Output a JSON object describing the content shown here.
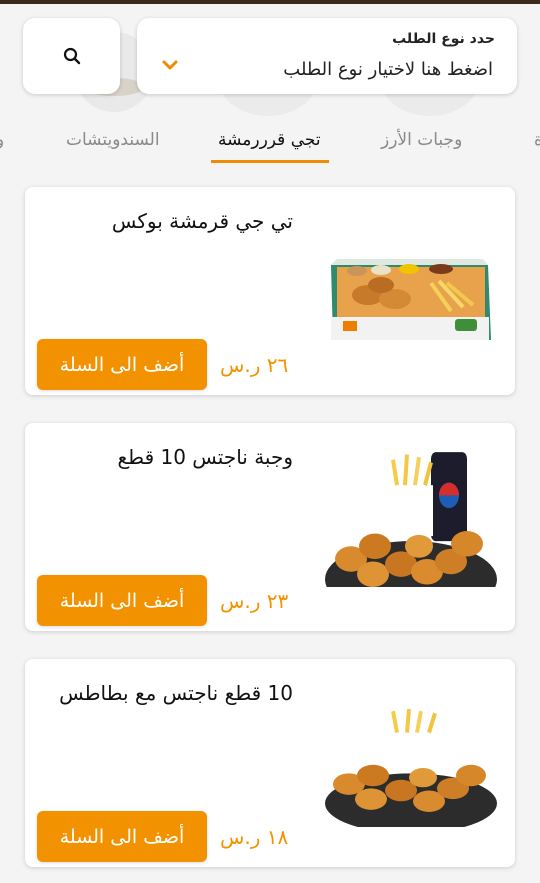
{
  "header": {
    "search_icon": "search-icon",
    "order_type": {
      "label": "حدد نوع الطلب",
      "value": "اضغط هنا لاختيار نوع الطلب"
    }
  },
  "tabs": [
    {
      "label": "و"
    },
    {
      "label": "السندويتشات"
    },
    {
      "label": "تجي قرررمشة"
    },
    {
      "label": "وجبات الأرز"
    },
    {
      "label": "ة"
    }
  ],
  "active_tab": "تجي قرررمشة",
  "products": [
    {
      "title": "تي جي قرمشة بوكس",
      "price": "٢٦ ر.س",
      "add_label": "أضف الى السلة",
      "image": "box-meal-image"
    },
    {
      "title": "وجبة ناجتس 10 قطع",
      "price": "٢٣ ر.س",
      "add_label": "أضف الى السلة",
      "image": "nuggets-meal-image"
    },
    {
      "title": "10 قطع ناجتس مع بطاطس",
      "price": "١٨ ر.س",
      "add_label": "أضف الى السلة",
      "image": "nuggets-fries-image"
    }
  ],
  "colors": {
    "accent": "#f39200",
    "tab_underline": "#f08c00",
    "background": "#f4f4f4"
  }
}
